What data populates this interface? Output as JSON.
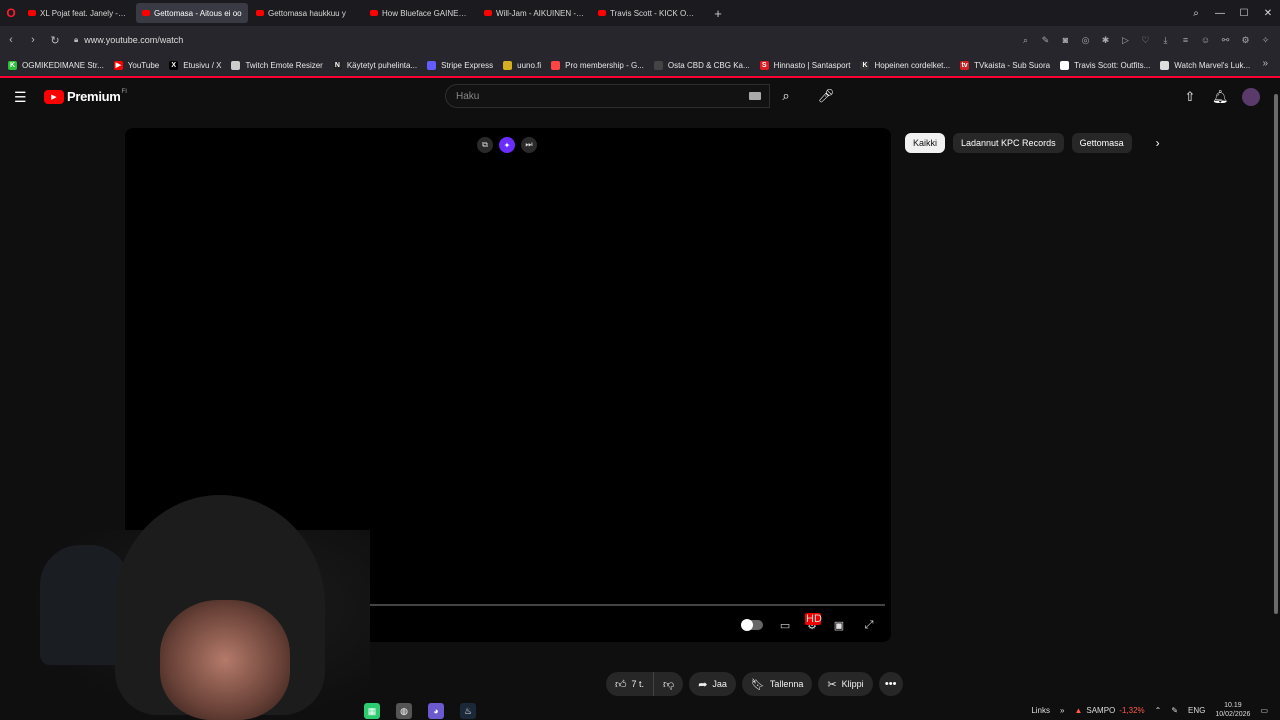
{
  "browser": {
    "tabs": [
      {
        "label": "XL Pojat feat. Janely - Tap",
        "active": false
      },
      {
        "label": "Gettomasa - Aitous ei oo",
        "active": true
      },
      {
        "label": "Gettomasa haukkuu y",
        "active": false
      },
      {
        "label": "How Blueface GAINED w",
        "active": false
      },
      {
        "label": "Will-Jam - AIKUINEN - Yo",
        "active": false
      },
      {
        "label": "Travis Scott - KICK OUT - Y",
        "active": false
      }
    ],
    "url": "www.youtube.com/watch",
    "bookmarks": [
      {
        "label": "OGMIKEDIMANE Str...",
        "icon_color": "#2fbf3a",
        "glyph": "K"
      },
      {
        "label": "YouTube",
        "icon_color": "#ff0000",
        "glyph": "▶"
      },
      {
        "label": "Etusivu / X",
        "icon_color": "#000000",
        "glyph": "X"
      },
      {
        "label": "Twitch Emote Resizer",
        "icon_color": "#cccccc",
        "glyph": ""
      },
      {
        "label": "Käytetyt puhelinta...",
        "icon_color": "#222222",
        "glyph": "N"
      },
      {
        "label": "Stripe Express",
        "icon_color": "#635bff",
        "glyph": ""
      },
      {
        "label": "uuno.fi",
        "icon_color": "#d4b020",
        "glyph": ""
      },
      {
        "label": "Pro membership - G...",
        "icon_color": "#ff4444",
        "glyph": ""
      },
      {
        "label": "Osta CBD & CBG Ka...",
        "icon_color": "#444444",
        "glyph": ""
      },
      {
        "label": "Hinnasto | Santasport",
        "icon_color": "#e21b23",
        "glyph": "S"
      },
      {
        "label": "Hopeinen cordelket...",
        "icon_color": "#333333",
        "glyph": "K"
      },
      {
        "label": "TVkaista - Sub Suora",
        "icon_color": "#cc2222",
        "glyph": "tv"
      },
      {
        "label": "Travis Scott: Outfits...",
        "icon_color": "#ffffff",
        "glyph": ""
      },
      {
        "label": "Watch Marvel's Luk...",
        "icon_color": "#dddddd",
        "glyph": ""
      }
    ]
  },
  "youtube": {
    "logo_text": "Premium",
    "logo_region": "FI",
    "search_placeholder": "Haku",
    "chips": [
      "Kaikki",
      "Ladannut KPC Records",
      "Gettomasa"
    ],
    "actions": {
      "like_count": "7 t.",
      "share": "Jaa",
      "save": "Tallenna",
      "clip": "Klippi"
    },
    "settings_badge": "HD"
  },
  "taskbar": {
    "links": "Links",
    "stock_name": "SAMPO",
    "stock_change": "-1,32%",
    "language": "ENG",
    "time": "10.19",
    "date": "10/02/2026"
  },
  "colors": {
    "accent": "#ff0000",
    "background": "#0f0f0f",
    "chip": "#272727"
  }
}
